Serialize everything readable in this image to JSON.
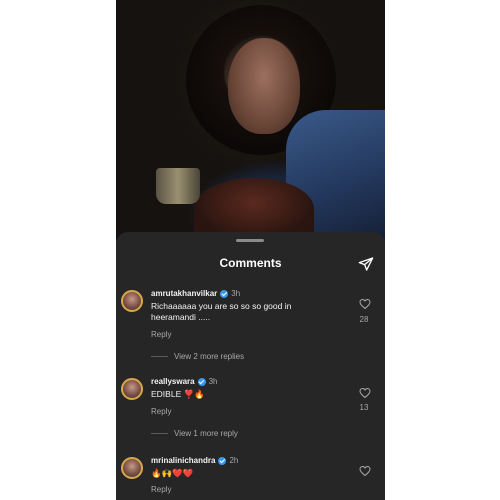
{
  "header": {
    "title": "Comments"
  },
  "comments": [
    {
      "username": "amrutakhanvilkar",
      "time": "3h",
      "text": "Richaaaaaa you are so so so good in heeramandi .....",
      "reply_label": "Reply",
      "likes": "28",
      "more_replies": "View 2 more replies"
    },
    {
      "username": "reallyswara",
      "time": "3h",
      "text": "EDIBLE ❣️🔥",
      "reply_label": "Reply",
      "likes": "13",
      "more_replies": "View 1 more reply"
    },
    {
      "username": "mrinalinichandra",
      "time": "2h",
      "text": "🔥🙌❤️❤️",
      "reply_label": "Reply",
      "likes": ""
    }
  ],
  "colors": {
    "sheet_background": "#262626",
    "verified_badge": "#3897f0",
    "secondary_text": "#a8a8a8"
  },
  "icons": {
    "share": "paper-plane-icon",
    "like": "heart-outline-icon",
    "verified": "verified-badge-icon"
  }
}
